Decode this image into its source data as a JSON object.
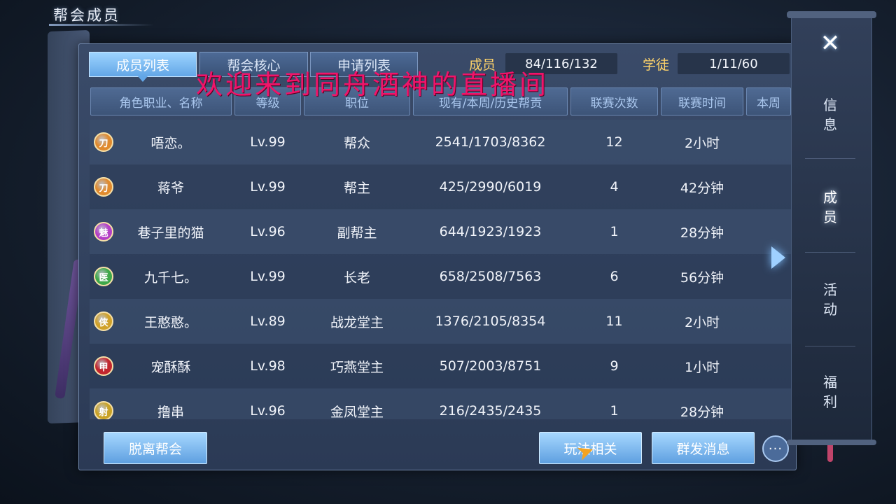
{
  "page_title": "帮会成员",
  "tabs": [
    {
      "label": "成员列表",
      "active": true
    },
    {
      "label": "帮会核心",
      "active": false
    },
    {
      "label": "申请列表",
      "active": false
    }
  ],
  "stats": {
    "members_label": "成员",
    "members_value": "84/116/132",
    "apprentices_label": "学徒",
    "apprentices_value": "1/11/60"
  },
  "stream_overlay": "欢迎来到同舟酒神的直播间",
  "columns": [
    "角色职业、名称",
    "等级",
    "职位",
    "现有/本周/历史帮贡",
    "联赛次数",
    "联赛时间",
    "本周"
  ],
  "members": [
    {
      "class_icon": "刀",
      "class_color": "#e08a2e",
      "name": "唔恋。",
      "level": "Lv.99",
      "rank": "帮众",
      "contribution": "2541/1703/8362",
      "league_count": "12",
      "league_time": "2小时"
    },
    {
      "class_icon": "刀",
      "class_color": "#e08a2e",
      "name": "蒋爷",
      "level": "Lv.99",
      "rank": "帮主",
      "contribution": "425/2990/6019",
      "league_count": "4",
      "league_time": "42分钟"
    },
    {
      "class_icon": "魅",
      "class_color": "#b43fc6",
      "name": "巷子里的猫",
      "level": "Lv.96",
      "rank": "副帮主",
      "contribution": "644/1923/1923",
      "league_count": "1",
      "league_time": "28分钟"
    },
    {
      "class_icon": "医",
      "class_color": "#3fa84a",
      "name": "九千七。",
      "level": "Lv.99",
      "rank": "长老",
      "contribution": "658/2508/7563",
      "league_count": "6",
      "league_time": "56分钟"
    },
    {
      "class_icon": "侠",
      "class_color": "#d0a12a",
      "name": "王憨憨。",
      "level": "Lv.89",
      "rank": "战龙堂主",
      "contribution": "1376/2105/8354",
      "league_count": "11",
      "league_time": "2小时"
    },
    {
      "class_icon": "甲",
      "class_color": "#c2262e",
      "name": "宠酥酥",
      "level": "Lv.98",
      "rank": "巧燕堂主",
      "contribution": "507/2003/8751",
      "league_count": "9",
      "league_time": "1小时"
    },
    {
      "class_icon": "射",
      "class_color": "#c9a226",
      "name": "撸串",
      "level": "Lv.96",
      "rank": "金凤堂主",
      "contribution": "216/2435/2435",
      "league_count": "1",
      "league_time": "28分钟"
    }
  ],
  "buttons": {
    "leave": "脱离帮会",
    "gameplay": "玩法相关",
    "mass_message": "群发消息",
    "more": "···"
  },
  "side_nav": {
    "close": "✕",
    "items": [
      {
        "label": "信息",
        "active": false
      },
      {
        "label": "成员",
        "active": true
      },
      {
        "label": "活动",
        "active": false
      },
      {
        "label": "福利",
        "active": false
      }
    ]
  }
}
